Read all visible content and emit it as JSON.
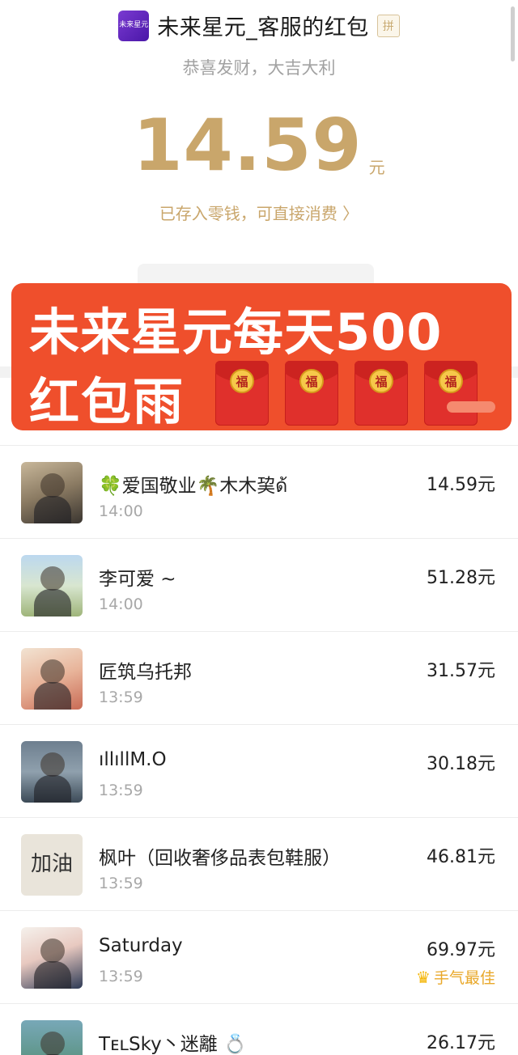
{
  "header": {
    "logo_text": "未来星元",
    "title": "未来星元_客服的红包",
    "pin_badge": "拼",
    "subtitle": "恭喜发财，大吉大利",
    "amount": "14.59",
    "currency": "元",
    "saved_link": "已存入零钱，可直接消费 〉"
  },
  "banner": {
    "line1": "未来星元每天500",
    "line2": "红包雨",
    "envelope_char": "福",
    "color": "#ef4f2c"
  },
  "recipients": [
    {
      "name": "🍀爱国敬业🌴木木巭ด้",
      "time": "14:00",
      "amount": "14.59元",
      "best": ""
    },
    {
      "name": "李可爱 ~",
      "time": "14:00",
      "amount": "51.28元",
      "best": ""
    },
    {
      "name": "匠筑乌托邦",
      "time": "13:59",
      "amount": "31.57元",
      "best": ""
    },
    {
      "name": "ıllıllM.O",
      "time": "13:59",
      "amount": "30.18元",
      "best": ""
    },
    {
      "name": "枫叶（回收奢侈品表包鞋服）",
      "time": "13:59",
      "amount": "46.81元",
      "best": "",
      "avatar_text": "加油"
    },
    {
      "name": "Saturday",
      "time": "13:59",
      "amount": "69.97元",
      "best": "手气最佳"
    },
    {
      "name": "TᴇʟSky丶迷離 💍",
      "time": "",
      "amount": "26.17元",
      "best": ""
    }
  ],
  "colors": {
    "gold": "#c9a66b",
    "best_luck": "#e9a82a"
  }
}
